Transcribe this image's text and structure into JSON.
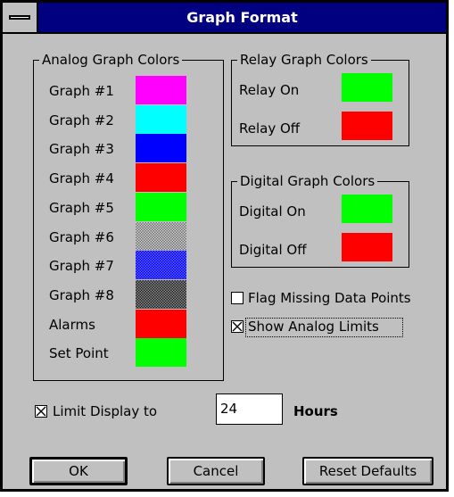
{
  "window": {
    "title": "Graph Format"
  },
  "analog": {
    "title": "Analog Graph Colors",
    "items": [
      {
        "label": "Graph #1",
        "color": "#ff00ff"
      },
      {
        "label": "Graph #2",
        "color": "#00ffff"
      },
      {
        "label": "Graph #3",
        "color": "#0000ff"
      },
      {
        "label": "Graph #4",
        "color": "#ff0000"
      },
      {
        "label": "Graph #5",
        "color": "#00ff00"
      },
      {
        "label": "Graph #6",
        "color": "#a8a8a8",
        "pattern": "dither-gray"
      },
      {
        "label": "Graph #7",
        "color": "#2020ff",
        "pattern": "dither-blue"
      },
      {
        "label": "Graph #8",
        "color": "#505050",
        "pattern": "dither-dark"
      },
      {
        "label": "Alarms",
        "color": "#ff0000"
      },
      {
        "label": "Set Point",
        "color": "#00ff00"
      }
    ]
  },
  "relay": {
    "title": "Relay Graph Colors",
    "items": [
      {
        "label": "Relay On",
        "color": "#00ff00"
      },
      {
        "label": "Relay Off",
        "color": "#ff0000"
      }
    ]
  },
  "digital": {
    "title": "Digital Graph Colors",
    "items": [
      {
        "label": "Digital On",
        "color": "#00ff00"
      },
      {
        "label": "Digital Off",
        "color": "#ff0000"
      }
    ]
  },
  "options": {
    "flag_missing": {
      "label": "Flag Missing Data Points",
      "checked": false
    },
    "show_limits": {
      "label": "Show Analog Limits",
      "checked": true
    },
    "limit_display": {
      "label": "Limit Display to",
      "checked": true,
      "value": "24",
      "unit": "Hours"
    }
  },
  "buttons": {
    "ok": "OK",
    "cancel": "Cancel",
    "reset": "Reset Defaults"
  }
}
